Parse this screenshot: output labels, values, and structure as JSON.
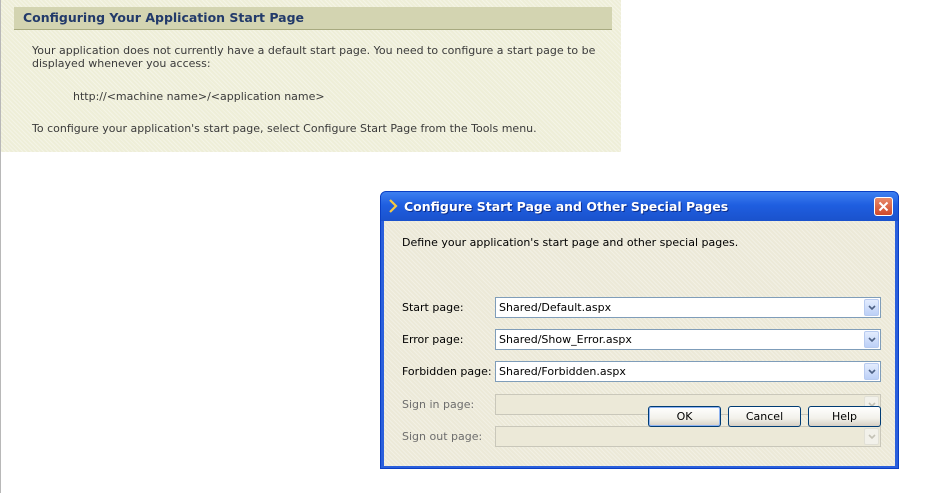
{
  "info_panel": {
    "title": "Configuring Your Application Start Page",
    "paragraph1": "Your application does not currently have a default start page.  You need to configure a start page to be displayed whenever you access:",
    "url": "http://<machine name>/<application name>",
    "paragraph2": "To configure your application's start page, select Configure Start Page from the Tools menu."
  },
  "dialog": {
    "title": "Configure Start Page and Other Special Pages",
    "title_icon": "chevron-right-icon",
    "close_icon": "close-icon",
    "description": "Define your application's start page and other special pages.",
    "fields": [
      {
        "label": "Start page:",
        "value": "Shared/Default.aspx",
        "enabled": true
      },
      {
        "label": "Error page:",
        "value": "Shared/Show_Error.aspx",
        "enabled": true
      },
      {
        "label": "Forbidden page:",
        "value": "Shared/Forbidden.aspx",
        "enabled": true
      },
      {
        "label": "Sign in page:",
        "value": "",
        "enabled": false
      },
      {
        "label": "Sign out page:",
        "value": "",
        "enabled": false
      }
    ],
    "buttons": {
      "ok": "OK",
      "cancel": "Cancel",
      "help": "Help"
    }
  },
  "colors": {
    "titlebar": "#1f5ee0",
    "info_title": "#223a6a",
    "panel_bg": "#eeeed8"
  }
}
